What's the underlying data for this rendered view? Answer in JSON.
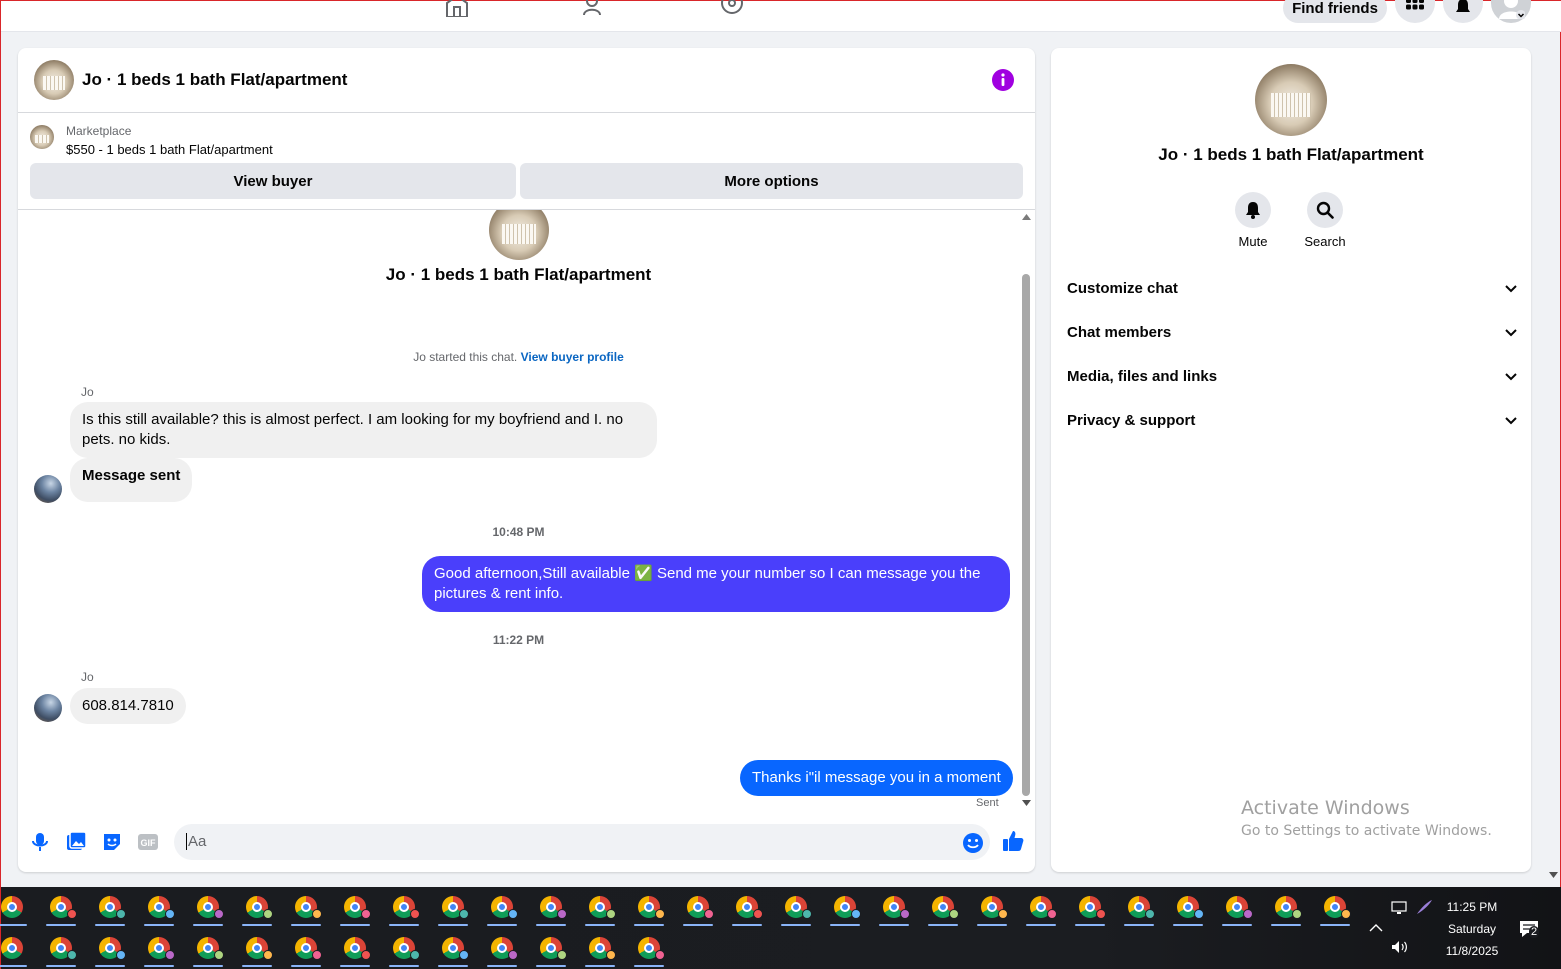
{
  "topbar": {
    "find_friends": "Find friends"
  },
  "chat": {
    "title": "Jo · 1 beds 1 bath Flat/apartment",
    "marketplace_label": "Marketplace",
    "listing": "$550 - 1 beds 1 bath Flat/apartment",
    "view_buyer": "View buyer",
    "more_options": "More options",
    "intro_name": "Jo · 1 beds 1 bath Flat/apartment",
    "started_text": "Jo started this chat.",
    "started_link": "View buyer profile",
    "messages": [
      {
        "sender": "Jo",
        "text": "Is this still available? this is almost perfect.  I am looking for my boyfriend and I. no pets. no kids."
      },
      {
        "text": "Message sent"
      },
      {
        "timestamp": "10:48 PM"
      },
      {
        "text": "Good afternoon,Still available ✅ Send me your number so I can message you the pictures & rent info."
      },
      {
        "timestamp": "11:22 PM"
      },
      {
        "sender": "Jo",
        "text": "608.814.7810"
      },
      {
        "text": "Thanks i\"il message you in a moment",
        "status": "Sent"
      }
    ],
    "composer_placeholder": "Aa"
  },
  "details": {
    "name": "Jo · 1 beds 1 bath Flat/apartment",
    "mute": "Mute",
    "search": "Search",
    "sections": [
      "Customize chat",
      "Chat members",
      "Media, files and links",
      "Privacy & support"
    ]
  },
  "watermark": {
    "line1": "Activate Windows",
    "line2": "Go to Settings to activate Windows."
  },
  "taskbar": {
    "time": "11:25 PM",
    "day": "Saturday",
    "date": "11/8/2025",
    "notifications": "2"
  },
  "colors": {
    "accent": "#4a3ffb",
    "link": "#0a66c2",
    "info": "#a000e0",
    "like": "#0866ff"
  }
}
